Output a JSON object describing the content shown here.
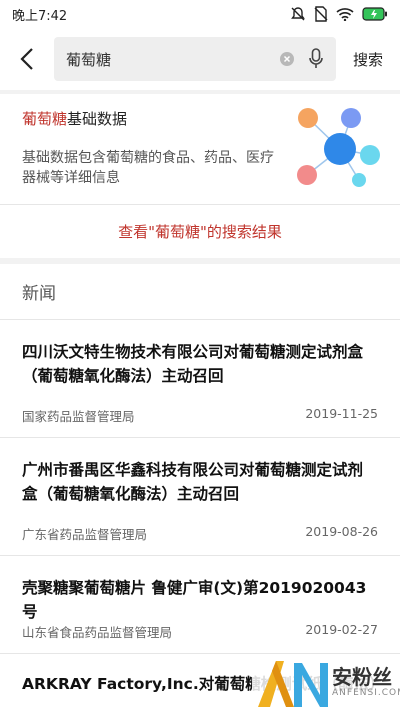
{
  "status": {
    "time": "晚上7:42"
  },
  "search": {
    "query": "葡萄糖",
    "submit_label": "搜索"
  },
  "basic": {
    "keyword": "葡萄糖",
    "title_suffix": "基础数据",
    "description": "基础数据包含葡萄糖的食品、药品、医疗器械等详细信息",
    "view_results_label": "查看\"葡萄糖\"的搜索结果"
  },
  "news": {
    "header": "新闻",
    "items": [
      {
        "title": "四川沃文特生物技术有限公司对葡萄糖测定试剂盒（葡萄糖氧化酶法）主动召回",
        "source": "国家药品监督管理局",
        "date": "2019-11-25"
      },
      {
        "title": "广州市番禺区华鑫科技有限公司对葡萄糖测定试剂盒（葡萄糖氧化酶法）主动召回",
        "source": "广东省药品监督管理局",
        "date": "2019-08-26"
      },
      {
        "title": "壳聚糖聚葡萄糖片 鲁健广审(文)第2019020043号",
        "source": "山东省食品药品监督管理局",
        "date": "2019-02-27"
      },
      {
        "title": "ARKRAY Factory,Inc.对葡萄糖检测试纸（酶法）进"
      }
    ]
  },
  "watermark": {
    "text": "安粉丝",
    "sub": "ANFENSI.COM"
  },
  "colors": {
    "accent": "#c0352d"
  }
}
